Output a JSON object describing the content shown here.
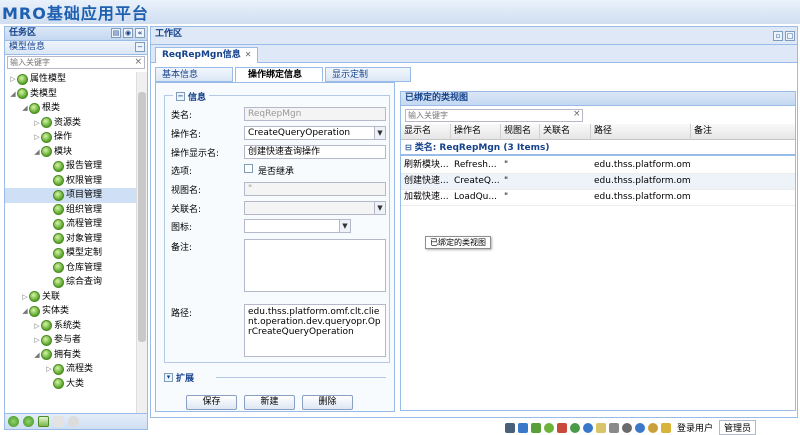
{
  "app": {
    "title": "MRO基础应用平台"
  },
  "left_panel": {
    "title": "任务区",
    "section_title": "模型信息",
    "collapse_symbol": "−",
    "search_placeholder": "输入关键字",
    "tree": [
      {
        "label": "属性模型",
        "level": 0,
        "expanded": false,
        "icon": "model-icon"
      },
      {
        "label": "类模型",
        "level": 0,
        "expanded": true,
        "icon": "model-icon"
      },
      {
        "label": "根类",
        "level": 1,
        "expanded": true,
        "icon": "class-icon"
      },
      {
        "label": "资源类",
        "level": 2,
        "expanded": false,
        "icon": "class-icon"
      },
      {
        "label": "操作",
        "level": 2,
        "expanded": false,
        "icon": "class-icon"
      },
      {
        "label": "模块",
        "level": 2,
        "expanded": true,
        "icon": "class-icon"
      },
      {
        "label": "报告管理",
        "level": 3,
        "icon": "class-icon"
      },
      {
        "label": "权限管理",
        "level": 3,
        "icon": "class-icon"
      },
      {
        "label": "项目管理",
        "level": 3,
        "icon": "class-icon",
        "selected": true
      },
      {
        "label": "组织管理",
        "level": 3,
        "icon": "class-icon"
      },
      {
        "label": "流程管理",
        "level": 3,
        "icon": "class-icon"
      },
      {
        "label": "对象管理",
        "level": 3,
        "icon": "class-icon"
      },
      {
        "label": "模型定制",
        "level": 3,
        "icon": "class-icon"
      },
      {
        "label": "仓库管理",
        "level": 3,
        "icon": "class-icon"
      },
      {
        "label": "综合查询",
        "level": 3,
        "icon": "class-icon"
      },
      {
        "label": "关联",
        "level": 1,
        "expanded": false,
        "icon": "class-icon"
      },
      {
        "label": "实体类",
        "level": 1,
        "expanded": true,
        "icon": "class-icon"
      },
      {
        "label": "系统类",
        "level": 2,
        "expanded": false,
        "icon": "class-icon"
      },
      {
        "label": "参与者",
        "level": 2,
        "expanded": false,
        "icon": "class-icon"
      },
      {
        "label": "拥有类",
        "level": 2,
        "expanded": true,
        "icon": "class-icon"
      },
      {
        "label": "流程类",
        "level": 3,
        "expanded": false,
        "icon": "class-icon"
      },
      {
        "label": "大类",
        "level": 3,
        "icon": "class-icon"
      }
    ]
  },
  "work_area": {
    "title": "工作区",
    "tab_label": "ReqRepMgn信息",
    "tab_close": "✕",
    "subtabs": [
      "基本信息",
      "操作绑定信息",
      "显示定制"
    ],
    "active_subtab": 1
  },
  "form": {
    "legend": "信息",
    "fields": {
      "class_name_label": "类名:",
      "class_name_value": "ReqRepMgn",
      "op_name_label": "操作名:",
      "op_name_value": "CreateQueryOperation",
      "op_display_label": "操作显示名:",
      "op_display_value": "创建快速查询操作",
      "option_label": "选项:",
      "inherit_label": "是否继承",
      "view_label": "视图名:",
      "view_value": "\"",
      "assoc_label": "关联名:",
      "assoc_value": "",
      "icon_label": "图标:",
      "icon_value": "",
      "note_label": "备注:",
      "note_value": "",
      "path_label": "路径:",
      "path_value": "edu.thss.platform.omf.clt.client.operation.dev.queryopr.OprCreateQueryOperation"
    },
    "expand_label": "扩展",
    "buttons": {
      "save": "保存",
      "new": "新建",
      "delete": "删除"
    }
  },
  "bound_views": {
    "title": "已绑定的类视图",
    "search_placeholder": "输入关键字",
    "columns": [
      "显示名",
      "操作名",
      "视图名",
      "关联名",
      "路径",
      "备注"
    ],
    "group_label": "类名: ReqRepMgn (3 Items)",
    "rows": [
      {
        "display": "刷新模块...",
        "op": "Refresh...",
        "view": "\"",
        "assoc": "",
        "path": "edu.thss.platform.omf...",
        "note": ""
      },
      {
        "display": "创建快速...",
        "op": "CreateQ...",
        "view": "\"",
        "assoc": "",
        "path": "edu.thss.platform.omf...",
        "note": ""
      },
      {
        "display": "加载快速...",
        "op": "LoadQu...",
        "view": "\"",
        "assoc": "",
        "path": "edu.thss.platform.omf...",
        "note": ""
      }
    ],
    "tooltip": "已绑定的类视图"
  },
  "status_bar": {
    "user_label": "登录用户",
    "user_value": "管理员"
  },
  "colors": {
    "accent": "#15428b",
    "border": "#99bbe8",
    "header_bg": "#dfe8f6"
  }
}
